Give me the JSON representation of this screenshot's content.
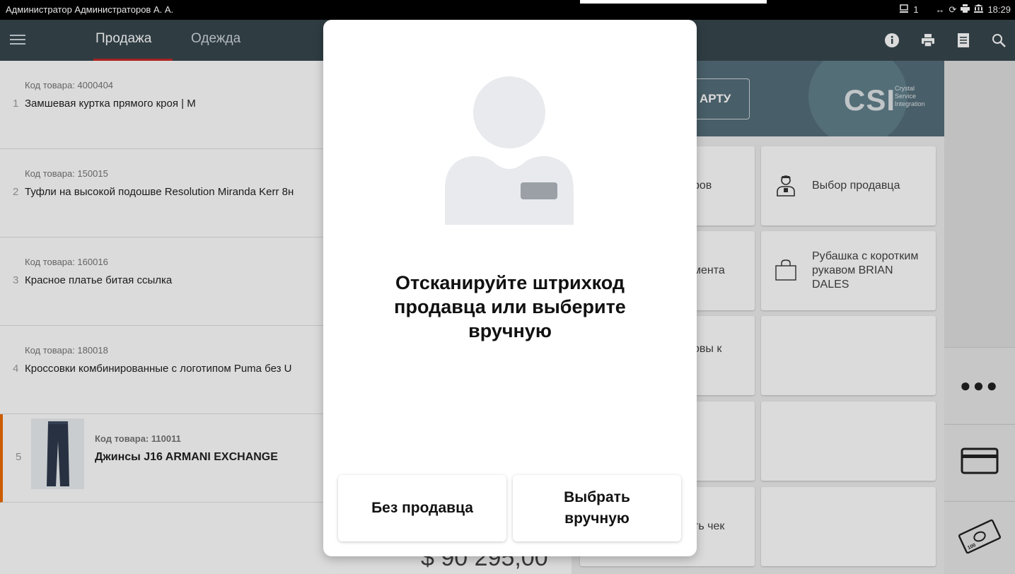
{
  "status_bar": {
    "operator": "Администратор Администраторов А. А.",
    "device_count": "1",
    "time": "18:29"
  },
  "app_bar": {
    "tabs": [
      {
        "label": "Продажа"
      },
      {
        "label": "Одежда"
      }
    ]
  },
  "receipt": {
    "items": [
      {
        "index": "1",
        "code": "Код товара: 4000404",
        "name": "Замшевая куртка прямого кроя | M"
      },
      {
        "index": "2",
        "code": "Код товара: 150015",
        "name": "Туфли на высокой подошве Resolution Miranda Kerr 8н"
      },
      {
        "index": "3",
        "code": "Код товара: 160016",
        "name": "Красное платье битая ссылка"
      },
      {
        "index": "4",
        "code": "Код товара: 180018",
        "name": "Кроссовки комбинированные с логотипом Puma без U"
      },
      {
        "index": "5",
        "code": "Код товара: 110011",
        "name": "Джинсы J16 ARMANI EXCHANGE"
      }
    ],
    "total_partial": "$ 90 295,00"
  },
  "right_panel": {
    "card_button_partial": "АРТУ",
    "logo": "CSI",
    "logo_sub": [
      "Crystal",
      "Service",
      "Integration"
    ],
    "tiles": [
      {
        "label": "ров"
      },
      {
        "label": "Выбор продавца"
      },
      {
        "label": "мента"
      },
      {
        "label": "Рубашка с коротким рукавом BRIAN DALES"
      },
      {
        "label": "овы к"
      },
      {
        "label": ""
      },
      {
        "label": ""
      },
      {
        "label": ""
      },
      {
        "label": "ть чек"
      },
      {
        "label": ""
      }
    ]
  },
  "modal": {
    "title": "Отсканируйте штрихкод продавца или выберите вручную",
    "button_no_seller": "Без продавца",
    "button_choose": "Выбрать вручную"
  },
  "colors": {
    "appbar": "#37474f",
    "brand": "#546e7a",
    "accent_red": "#c62828",
    "selected_orange": "#ef6c00"
  }
}
